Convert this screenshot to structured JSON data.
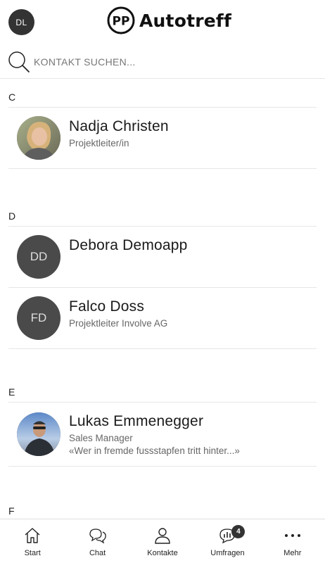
{
  "header": {
    "user_initials": "DL",
    "app_name": "Autotreff",
    "logo_mark": "PP"
  },
  "search": {
    "placeholder": "KONTAKT SUCHEN..."
  },
  "sections": [
    {
      "letter": "C",
      "contacts": [
        {
          "name": "Nadja Christen",
          "role": "Projektleiter/in",
          "status": "",
          "initials": "",
          "photo": true
        }
      ]
    },
    {
      "letter": "D",
      "contacts": [
        {
          "name": "Debora Demoapp",
          "role": "",
          "status": "",
          "initials": "DD",
          "photo": false
        },
        {
          "name": "Falco Doss",
          "role": "Projektleiter Involve AG",
          "status": "",
          "initials": "FD",
          "photo": false
        }
      ]
    },
    {
      "letter": "E",
      "contacts": [
        {
          "name": "Lukas Emmenegger",
          "role": "Sales Manager",
          "status": "«Wer in fremde fussstapfen tritt hinter...»",
          "initials": "",
          "photo": true
        }
      ]
    },
    {
      "letter": "F",
      "contacts": []
    }
  ],
  "tabbar": {
    "items": [
      {
        "label": "Start",
        "icon": "home-icon"
      },
      {
        "label": "Chat",
        "icon": "chat-icon"
      },
      {
        "label": "Kontakte",
        "icon": "person-icon"
      },
      {
        "label": "Umfragen",
        "icon": "poll-icon",
        "badge": "4"
      },
      {
        "label": "Mehr",
        "icon": "more-dots-icon"
      }
    ]
  },
  "colors": {
    "avatar_bg": "#4a4a4a",
    "badge_bg": "#333333",
    "divider": "#e6e6e6"
  }
}
